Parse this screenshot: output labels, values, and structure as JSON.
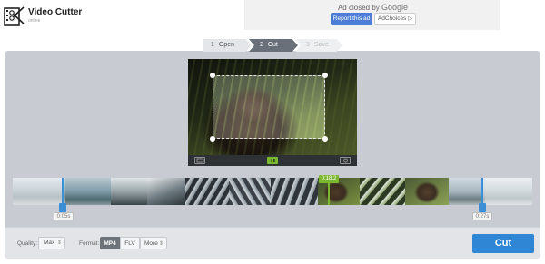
{
  "header": {
    "title": "Video Cutter",
    "subtitle": "online"
  },
  "ad": {
    "closed_prefix": "Ad closed by ",
    "closed_brand": "Google",
    "report_label": "Report this ad",
    "choices_label": "AdChoices ▷"
  },
  "steps": [
    {
      "number": "1",
      "label": "Open"
    },
    {
      "number": "2",
      "label": "Cut"
    },
    {
      "number": "3",
      "label": "Save"
    }
  ],
  "timeline": {
    "start_time": "0:05s",
    "end_time": "0:27s",
    "position_time": "0:18.2"
  },
  "footer": {
    "quality_label": "Quality:",
    "quality_value": "Max",
    "format_label": "Format:",
    "formats": [
      "MP4",
      "FLV",
      "More"
    ],
    "selected_format": "MP4",
    "cut_label": "Cut"
  },
  "colors": {
    "accent": "#2f86d4",
    "active_step": "#6a7079",
    "play_green": "#7cb82f",
    "ad_button": "#4d7dd6"
  },
  "icons": [
    "film-icon",
    "crop-icon",
    "pause-icon",
    "rotate-icon",
    "sort-arrows-icon",
    "adchoices-icon"
  ]
}
